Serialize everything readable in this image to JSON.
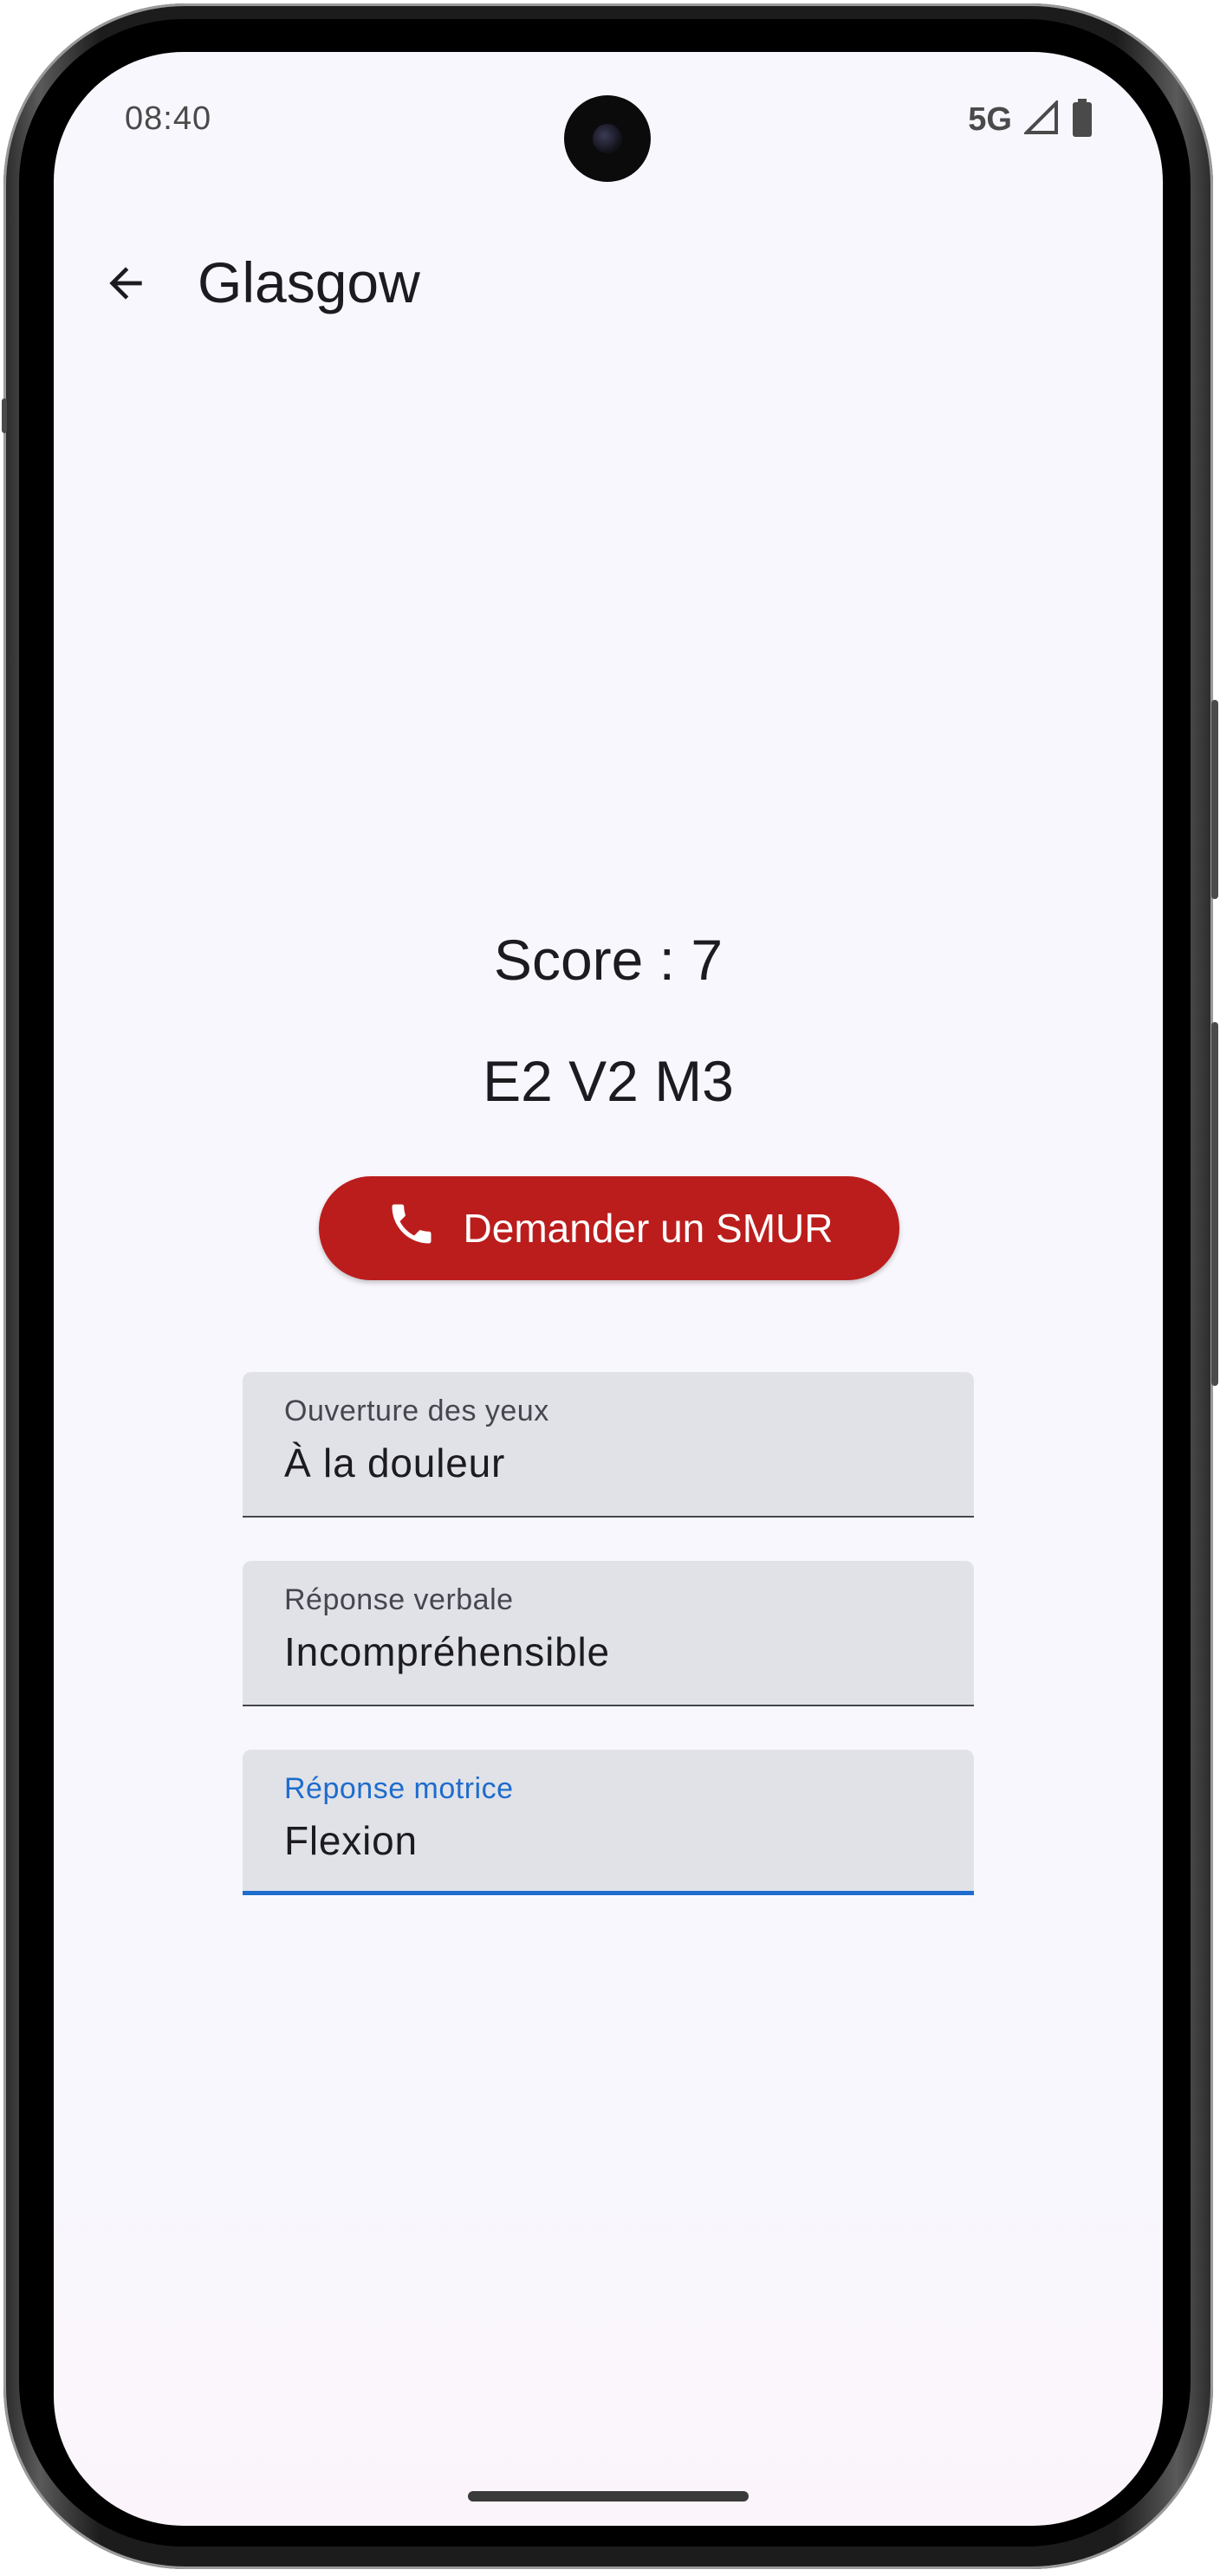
{
  "status_bar": {
    "time": "08:40",
    "network": "5G",
    "icons": [
      "signal-icon",
      "battery-icon"
    ]
  },
  "app_bar": {
    "back_icon": "arrow-back-icon",
    "title": "Glasgow"
  },
  "result": {
    "score": "Score : 7",
    "detail": "E2 V2 M3"
  },
  "smur_button": {
    "icon": "phone-icon",
    "label": "Demander un SMUR",
    "color": "#bb1d1c"
  },
  "fields": [
    {
      "label": "Ouverture des yeux",
      "value": "À la douleur",
      "focused": false
    },
    {
      "label": "Réponse verbale",
      "value": "Incompréhensible",
      "focused": false
    },
    {
      "label": "Réponse motrice",
      "value": "Flexion",
      "focused": true
    }
  ],
  "colors": {
    "accent": "#1e6ccc",
    "background": "#f8f7fd",
    "field_fill": "#e1e2e8"
  }
}
